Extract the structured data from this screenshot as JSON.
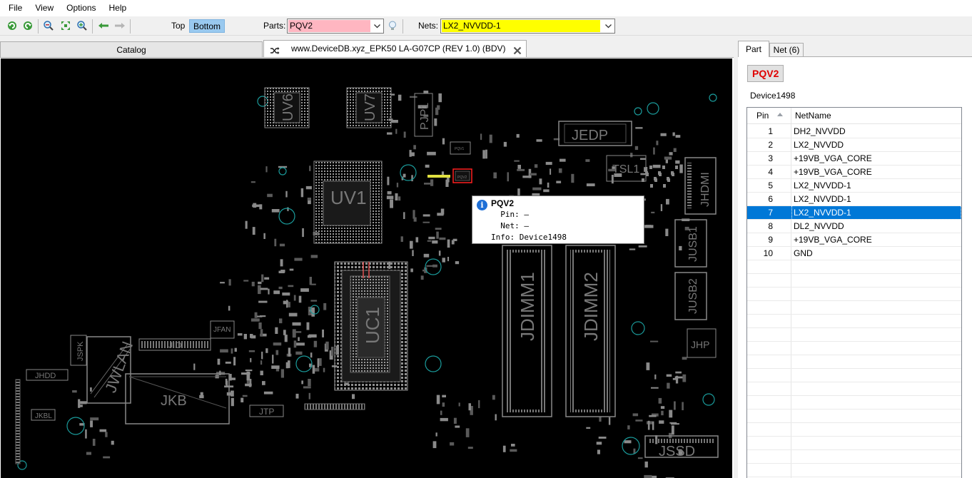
{
  "menu": [
    "File",
    "View",
    "Options",
    "Help"
  ],
  "toolbar": {
    "side_top": "Top",
    "side_bottom": "Bottom",
    "parts_label": "Parts:",
    "parts_value": "PQV2",
    "parts_bg": "#ffb6c1",
    "nets_label": "Nets:",
    "nets_value": "LX2_NVVDD-1",
    "nets_bg": "#ffff00"
  },
  "tabs": {
    "catalog": "Catalog",
    "board": "www.DeviceDB.xyz_EPK50 LA-G07CP (REV 1.0) (BDV)"
  },
  "board_labels": {
    "uv6": "UV6",
    "uv7": "UV7",
    "pjp1": "PJP1",
    "jedp": "JEDP",
    "tsl1": "TSL1",
    "jhdmi": "JHDMI",
    "uv1": "UV1",
    "uc1": "UC1",
    "jdimm1": "JDIMM1",
    "jdimm2": "JDIMM2",
    "jusb1": "JUSB1",
    "jusb2": "JUSB2",
    "jhp": "JHP",
    "jfan": "JFAN",
    "jio": "JIO",
    "jspk": "JSPK",
    "jwlan": "JWLAN",
    "jkb": "JKB",
    "jhdd": "JHDD",
    "jkbl": "JKBL",
    "jtp": "JTP",
    "jssd": "JSSD",
    "pqv2": "PQV2",
    "pqv1": "PQV1"
  },
  "tooltip": {
    "title": "PQV2",
    "pin": "  Pin: —",
    "net": "  Net: —",
    "info": "Info: Device1498"
  },
  "panel": {
    "tab_part": "Part",
    "tab_net": "Net (6)",
    "part_name": "PQV2",
    "part_desc": "Device1498",
    "col_pin": "Pin",
    "col_net": "NetName",
    "rows": [
      {
        "pin": "1",
        "net": "DH2_NVVDD"
      },
      {
        "pin": "2",
        "net": "LX2_NVVDD"
      },
      {
        "pin": "3",
        "net": "+19VB_VGA_CORE"
      },
      {
        "pin": "4",
        "net": "+19VB_VGA_CORE"
      },
      {
        "pin": "5",
        "net": "LX2_NVVDD-1"
      },
      {
        "pin": "6",
        "net": "LX2_NVVDD-1"
      },
      {
        "pin": "7",
        "net": "LX2_NVVDD-1"
      },
      {
        "pin": "8",
        "net": "DL2_NVVDD"
      },
      {
        "pin": "9",
        "net": "+19VB_VGA_CORE"
      },
      {
        "pin": "10",
        "net": "GND"
      }
    ],
    "selected_row": 7
  },
  "colors": {
    "accent": "#0078d7",
    "part_name": "#e00000",
    "board_bg": "#000000",
    "silkscreen": "#8a8a8a",
    "highlight": "#ff0000",
    "trace_cyan": "#1aa3a3"
  }
}
